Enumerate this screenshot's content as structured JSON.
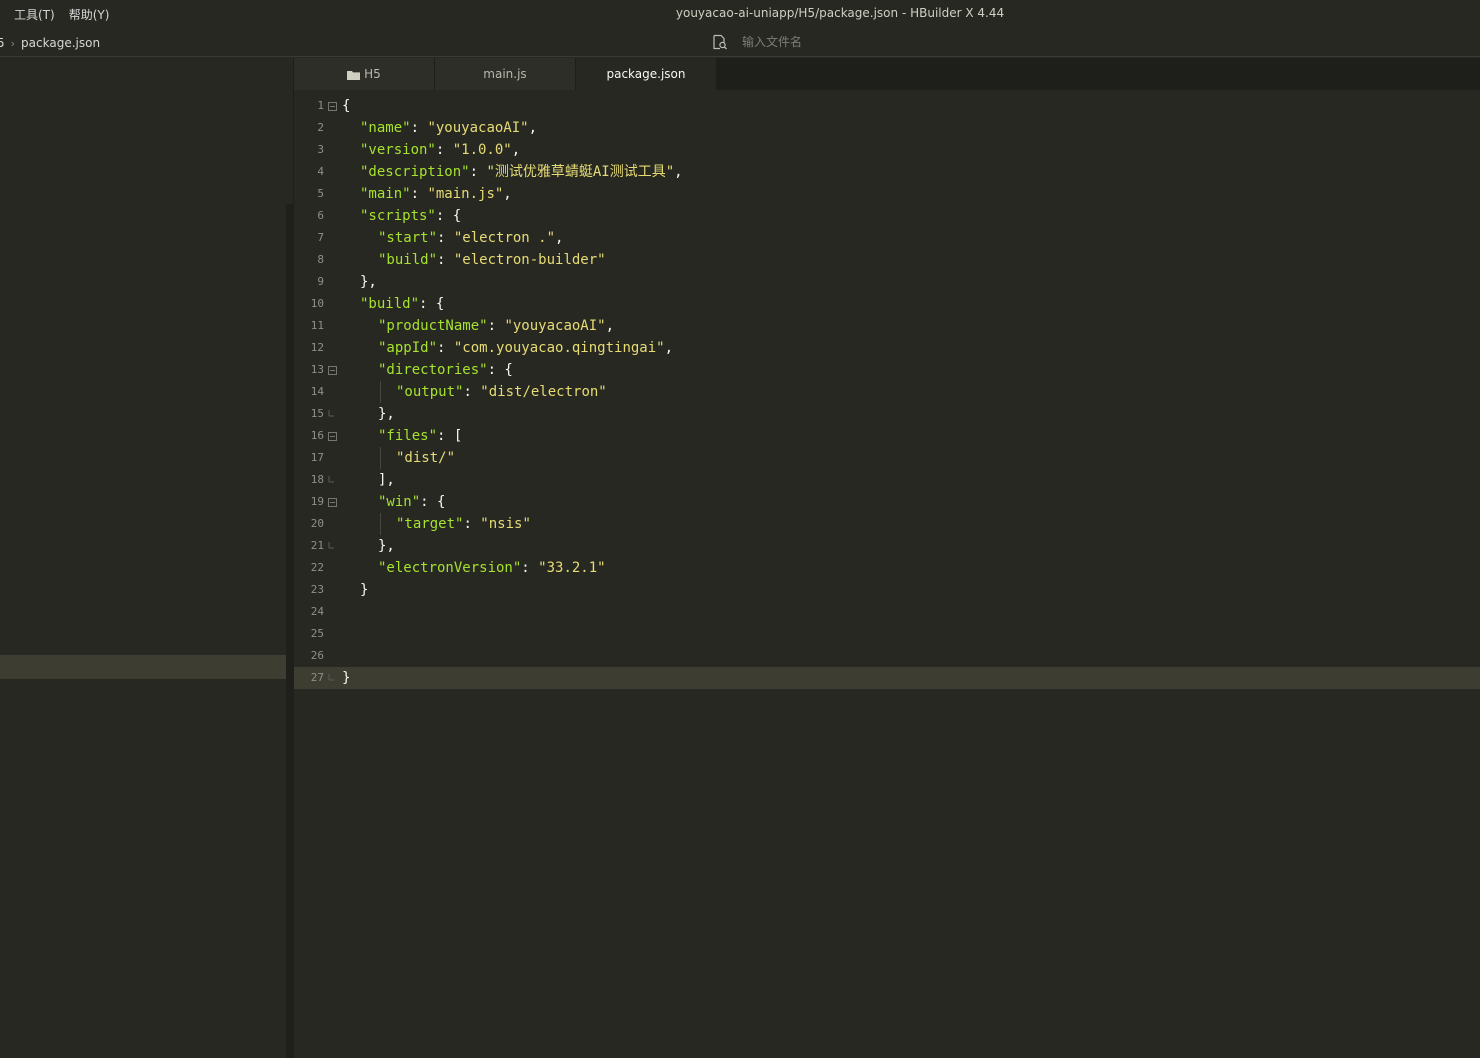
{
  "menu": {
    "tools": "工具(T)",
    "help": "帮助(Y)"
  },
  "window_title": "youyacao-ai-uniapp/H5/package.json - HBuilder X 4.44",
  "breadcrumb": {
    "parent": "5",
    "file": "package.json"
  },
  "file_search": {
    "placeholder": "输入文件名"
  },
  "tabs": [
    {
      "label": "H5",
      "icon": "folder-icon",
      "active": false
    },
    {
      "label": "main.js",
      "active": false
    },
    {
      "label": "package.json",
      "active": true
    }
  ],
  "colors": {
    "key": "#a6e22e",
    "string": "#e6db74",
    "punct": "#f8f8f2",
    "background": "#272822"
  },
  "editor": {
    "current_line": 27,
    "lines": [
      {
        "n": "1",
        "indent": 0,
        "tokens": [
          [
            "p",
            "{"
          ]
        ],
        "fold": "open"
      },
      {
        "n": "2",
        "indent": 1,
        "tokens": [
          [
            "k",
            "\"name\""
          ],
          [
            "p",
            ": "
          ],
          [
            "s",
            "\"youyacaoAI\""
          ],
          [
            "p",
            ","
          ]
        ]
      },
      {
        "n": "3",
        "indent": 1,
        "tokens": [
          [
            "k",
            "\"version\""
          ],
          [
            "p",
            ": "
          ],
          [
            "s",
            "\"1.0.0\""
          ],
          [
            "p",
            ","
          ]
        ]
      },
      {
        "n": "4",
        "indent": 1,
        "tokens": [
          [
            "k",
            "\"description\""
          ],
          [
            "p",
            ": "
          ],
          [
            "s",
            "\"测试优雅草蜻蜓AI测试工具\""
          ],
          [
            "p",
            ","
          ]
        ]
      },
      {
        "n": "5",
        "indent": 1,
        "tokens": [
          [
            "k",
            "\"main\""
          ],
          [
            "p",
            ": "
          ],
          [
            "s",
            "\"main.js\""
          ],
          [
            "p",
            ","
          ]
        ]
      },
      {
        "n": "6",
        "indent": 1,
        "tokens": [
          [
            "k",
            "\"scripts\""
          ],
          [
            "p",
            ": {"
          ]
        ]
      },
      {
        "n": "7",
        "indent": 2,
        "tokens": [
          [
            "k",
            "\"start\""
          ],
          [
            "p",
            ": "
          ],
          [
            "s",
            "\"electron .\""
          ],
          [
            "p",
            ","
          ]
        ]
      },
      {
        "n": "8",
        "indent": 2,
        "tokens": [
          [
            "k",
            "\"build\""
          ],
          [
            "p",
            ": "
          ],
          [
            "s",
            "\"electron-builder\""
          ]
        ]
      },
      {
        "n": "9",
        "indent": 1,
        "tokens": [
          [
            "p",
            "},"
          ]
        ]
      },
      {
        "n": "10",
        "indent": 1,
        "tokens": [
          [
            "k",
            "\"build\""
          ],
          [
            "p",
            ": {"
          ]
        ]
      },
      {
        "n": "11",
        "indent": 2,
        "tokens": [
          [
            "k",
            "\"productName\""
          ],
          [
            "p",
            ": "
          ],
          [
            "s",
            "\"youyacaoAI\""
          ],
          [
            "p",
            ","
          ]
        ]
      },
      {
        "n": "12",
        "indent": 2,
        "tokens": [
          [
            "k",
            "\"appId\""
          ],
          [
            "p",
            ": "
          ],
          [
            "s",
            "\"com.youyacao.qingtingai\""
          ],
          [
            "p",
            ","
          ]
        ]
      },
      {
        "n": "13",
        "indent": 2,
        "tokens": [
          [
            "k",
            "\"directories\""
          ],
          [
            "p",
            ": {"
          ]
        ],
        "fold": "open"
      },
      {
        "n": "14",
        "indent": 3,
        "tokens": [
          [
            "k",
            "\"output\""
          ],
          [
            "p",
            ": "
          ],
          [
            "s",
            "\"dist/electron\""
          ]
        ]
      },
      {
        "n": "15",
        "indent": 2,
        "tokens": [
          [
            "p",
            "},"
          ]
        ],
        "fold": "end"
      },
      {
        "n": "16",
        "indent": 2,
        "tokens": [
          [
            "k",
            "\"files\""
          ],
          [
            "p",
            ": ["
          ]
        ],
        "fold": "open"
      },
      {
        "n": "17",
        "indent": 3,
        "tokens": [
          [
            "s",
            "\"dist/\""
          ]
        ]
      },
      {
        "n": "18",
        "indent": 2,
        "tokens": [
          [
            "p",
            "],"
          ]
        ],
        "fold": "end"
      },
      {
        "n": "19",
        "indent": 2,
        "tokens": [
          [
            "k",
            "\"win\""
          ],
          [
            "p",
            ": {"
          ]
        ],
        "fold": "open"
      },
      {
        "n": "20",
        "indent": 3,
        "tokens": [
          [
            "k",
            "\"target\""
          ],
          [
            "p",
            ": "
          ],
          [
            "s",
            "\"nsis\""
          ]
        ]
      },
      {
        "n": "21",
        "indent": 2,
        "tokens": [
          [
            "p",
            "},"
          ]
        ],
        "fold": "end"
      },
      {
        "n": "22",
        "indent": 2,
        "tokens": [
          [
            "k",
            "\"electronVersion\""
          ],
          [
            "p",
            ": "
          ],
          [
            "s",
            "\"33.2.1\""
          ]
        ]
      },
      {
        "n": "23",
        "indent": 1,
        "tokens": [
          [
            "p",
            "}"
          ]
        ]
      },
      {
        "n": "24",
        "indent": 0,
        "tokens": []
      },
      {
        "n": "25",
        "indent": 0,
        "tokens": []
      },
      {
        "n": "26",
        "indent": 0,
        "tokens": []
      },
      {
        "n": "27",
        "indent": 0,
        "tokens": [
          [
            "p",
            "}"
          ]
        ],
        "fold": "end"
      }
    ]
  }
}
